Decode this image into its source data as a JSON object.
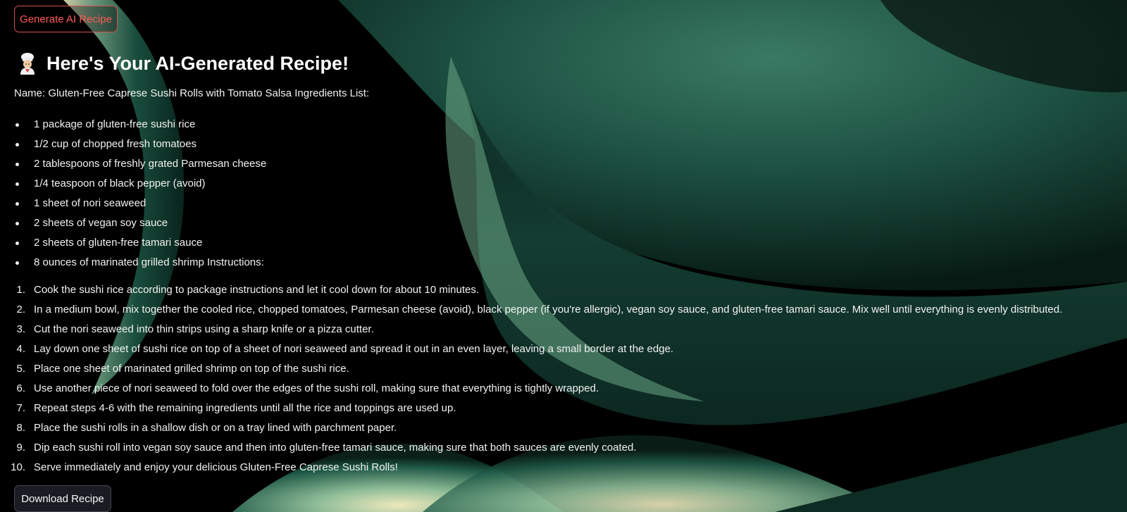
{
  "header": {
    "generate_button": "Generate AI Recipe"
  },
  "recipe": {
    "title_icon": "chef-icon",
    "title": "Here's Your AI-Generated Recipe!",
    "name_line": "Name: Gluten-Free Caprese Sushi Rolls with Tomato Salsa Ingredients List:",
    "ingredients": [
      "1 package of gluten-free sushi rice",
      "1/2 cup of chopped fresh tomatoes",
      "2 tablespoons of freshly grated Parmesan cheese",
      "1/4 teaspoon of black pepper (avoid)",
      "1 sheet of nori seaweed",
      "2 sheets of vegan soy sauce",
      "2 sheets of gluten-free tamari sauce",
      "8 ounces of marinated grilled shrimp Instructions:"
    ],
    "steps": [
      {
        "num": "1.",
        "text": "Cook the sushi rice according to package instructions and let it cool down for about 10 minutes."
      },
      {
        "num": "2.",
        "text": "In a medium bowl, mix together the cooled rice, chopped tomatoes, Parmesan cheese (avoid), black pepper (if you're allergic), vegan soy sauce, and gluten-free tamari sauce. Mix well until everything is evenly distributed."
      },
      {
        "num": "3.",
        "text": "Cut the nori seaweed into thin strips using a sharp knife or a pizza cutter."
      },
      {
        "num": "4.",
        "text": "Lay down one sheet of sushi rice on top of a sheet of nori seaweed and spread it out in an even layer, leaving a small border at the edge."
      },
      {
        "num": "5.",
        "text": "Place one sheet of marinated grilled shrimp on top of the sushi rice."
      },
      {
        "num": "6.",
        "text": "Use another piece of nori seaweed to fold over the edges of the sushi roll, making sure that everything is tightly wrapped."
      },
      {
        "num": "7.",
        "text": "Repeat steps 4-6 with the remaining ingredients until all the rice and toppings are used up."
      },
      {
        "num": "8.",
        "text": "Place the sushi rolls in a shallow dish or on a tray lined with parchment paper."
      },
      {
        "num": "9.",
        "text": "Dip each sushi roll into vegan soy sauce and then into gluten-free tamari sauce, making sure that both sauces are evenly coated."
      },
      {
        "num": "10.",
        "text": "Serve immediately and enjoy your delicious Gluten-Free Caprese Sushi Rolls!"
      }
    ]
  },
  "footer": {
    "download_button": "Download Recipe"
  },
  "colors": {
    "background": "#000000",
    "wave_green": "#1f5a48",
    "wave_highlight": "#e9e4b4",
    "generate_button_accent": "#ff5a55"
  }
}
